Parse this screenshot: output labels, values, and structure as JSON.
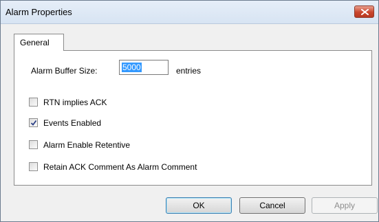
{
  "window": {
    "title": "Alarm Properties",
    "close_icon": "close-icon"
  },
  "tabs": [
    {
      "label": "General",
      "selected": true
    }
  ],
  "general": {
    "buffer_label": "Alarm Buffer Size:",
    "buffer_value": "5000",
    "buffer_unit": "entries",
    "options": [
      {
        "label": "RTN implies ACK",
        "checked": false
      },
      {
        "label": "Events Enabled",
        "checked": true
      },
      {
        "label": "Alarm Enable Retentive",
        "checked": false
      },
      {
        "label": "Retain ACK Comment As Alarm Comment",
        "checked": false
      }
    ]
  },
  "buttons": {
    "ok": "OK",
    "cancel": "Cancel",
    "apply": "Apply"
  }
}
